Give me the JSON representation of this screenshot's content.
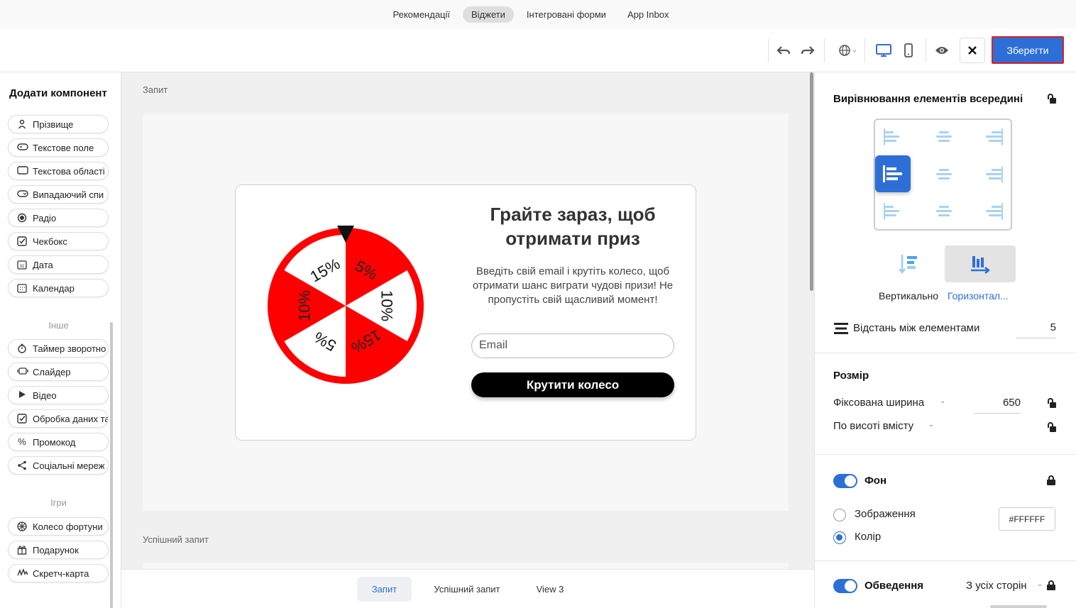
{
  "topnav": {
    "tabs": [
      "Рекомендації",
      "Віджети",
      "Інтегровані форми",
      "App Inbox"
    ],
    "active": "Віджети"
  },
  "toolbar": {
    "save_label": "Зберегти",
    "icons": [
      "undo-icon",
      "redo-icon",
      "globe-icon",
      "desktop-icon",
      "mobile-icon",
      "eye-icon",
      "close-icon"
    ]
  },
  "left": {
    "title": "Додати компонент",
    "inputs": [
      {
        "label": "Прізвище",
        "icon": "user-icon"
      },
      {
        "label": "Текстове поле",
        "icon": "textfield-icon"
      },
      {
        "label": "Текстова області",
        "icon": "textarea-icon"
      },
      {
        "label": "Випадаючий спи",
        "icon": "dropdown-icon"
      },
      {
        "label": "Радіо",
        "icon": "radio-icon"
      },
      {
        "label": "Чекбокс",
        "icon": "checkbox-icon"
      },
      {
        "label": "Дата",
        "icon": "date-icon"
      },
      {
        "label": "Календар",
        "icon": "calendar-icon"
      }
    ],
    "other_label": "Інше",
    "other": [
      {
        "label": "Таймер зворотно",
        "icon": "timer-icon"
      },
      {
        "label": "Слайдер",
        "icon": "slider-icon"
      },
      {
        "label": "Відео",
        "icon": "play-icon"
      },
      {
        "label": "Обробка даних та",
        "icon": "checkbox-icon"
      },
      {
        "label": "Промокод",
        "icon": "percent-icon"
      },
      {
        "label": "Соціальні мереж",
        "icon": "share-icon"
      }
    ],
    "games_label": "Ігри",
    "games": [
      {
        "label": "Колесо фортуни",
        "icon": "wheel-icon"
      },
      {
        "label": "Подарунок",
        "icon": "gift-icon"
      },
      {
        "label": "Скретч-карта",
        "icon": "scratch-icon"
      }
    ]
  },
  "canvas": {
    "label1": "Запит",
    "label2": "Успішний запит",
    "popup": {
      "title": "Грайте зараз, щоб отримати приз",
      "description": "Введіть свій email і крутіть колесо, щоб отримати шанс виграти чудові призи! Не пропустіть свій щасливий момент!",
      "email_placeholder": "Email",
      "spin_label": "Крутити колесо",
      "wheel_segments": [
        "5%",
        "10%",
        "15%",
        "5%",
        "10%",
        "15%"
      ],
      "wheel_colors": [
        "#ff0000",
        "#ffffff"
      ]
    }
  },
  "bottom_tabs": [
    "Запит",
    "Успішний запит",
    "View 3"
  ],
  "right": {
    "align_title": "Вирівнювання елементів всередині",
    "dir_vertical": "Вертикально",
    "dir_horizontal": "Горизонтал...",
    "spacing_label": "Відстань між елементами",
    "spacing_value": "5",
    "size_title": "Розмір",
    "width_label": "Фіксована ширина",
    "width_value": "650",
    "height_label": "По висоті вмісту",
    "bg_label": "Фон",
    "bg_image": "Зображення",
    "bg_color": "Колір",
    "bg_color_value": "#FFFFFF",
    "border_label": "Обведення",
    "border_sides": "З усіх сторін",
    "accent": "#2d6fd6"
  }
}
